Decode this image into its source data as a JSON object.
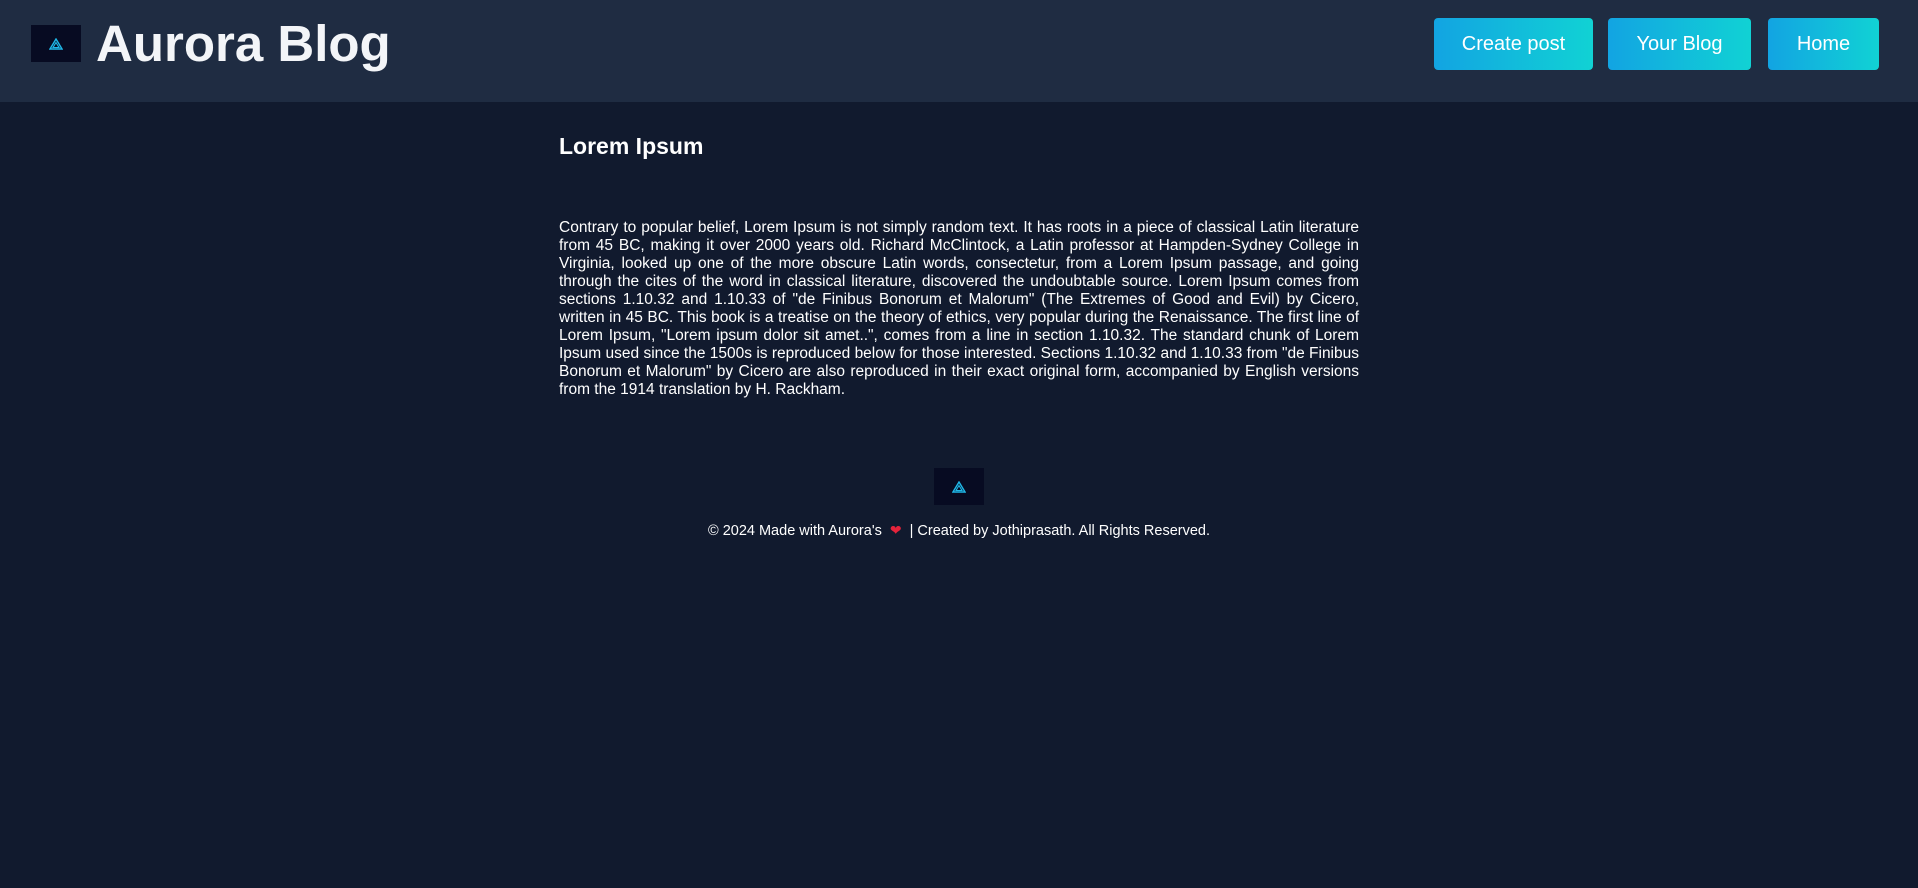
{
  "header": {
    "logo_icon": "aurora-triangle-logo",
    "title": "Aurora Blog",
    "nav": {
      "create_post": "Create post",
      "your_blog": "Your Blog",
      "home": "Home"
    }
  },
  "post": {
    "title": "Lorem Ipsum",
    "body": "Contrary to popular belief, Lorem Ipsum is not simply random text. It has roots in a piece of classical Latin literature from 45 BC, making it over 2000 years old. Richard McClintock, a Latin professor at Hampden-Sydney College in Virginia, looked up one of the more obscure Latin words, consectetur, from a Lorem Ipsum passage, and going through the cites of the word in classical literature, discovered the undoubtable source. Lorem Ipsum comes from sections 1.10.32 and 1.10.33 of \"de Finibus Bonorum et Malorum\" (The Extremes of Good and Evil) by Cicero, written in 45 BC. This book is a treatise on the theory of ethics, very popular during the Renaissance. The first line of Lorem Ipsum, \"Lorem ipsum dolor sit amet..\", comes from a line in section 1.10.32. The standard chunk of Lorem Ipsum used since the 1500s is reproduced below for those interested. Sections 1.10.32 and 1.10.33 from \"de Finibus Bonorum et Malorum\" by Cicero are also reproduced in their exact original form, accompanied by English versions from the 1914 translation by H. Rackham."
  },
  "footer": {
    "logo_icon": "aurora-triangle-logo",
    "text_before": "© 2024 Made with Aurora's",
    "heart_icon": "heart-icon",
    "heart_glyph": "❤",
    "text_after": "| Created by Jothiprasath. All Rights Reserved."
  },
  "colors": {
    "background": "#111a2e",
    "header_background": "#1f2c42",
    "button_gradient_start": "#12a4e2",
    "button_gradient_end": "#11d2d4",
    "logo_background": "#070b22",
    "logo_accent": "#1fb8e8",
    "heart": "#e5233b"
  }
}
